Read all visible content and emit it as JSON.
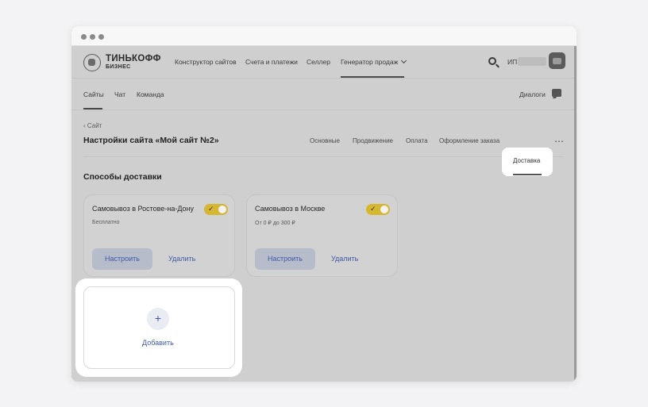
{
  "brand": {
    "name": "ТИНЬКОФФ",
    "subtitle": "БИЗНЕС"
  },
  "top_nav": {
    "items": [
      "Конструктор сайтов",
      "Счета и платежи",
      "Селлер",
      "Генератор продаж"
    ],
    "account_label": "ИП"
  },
  "sub_nav": {
    "items": [
      "Сайты",
      "Чат",
      "Команда"
    ],
    "dialogs_label": "Диалоги"
  },
  "page": {
    "back_label": "Сайт",
    "title": "Настройки сайта «Мой сайт №2»",
    "tabs": [
      "Основные",
      "Продвижение",
      "Оплата",
      "Оформление заказа",
      "Доставка"
    ],
    "active_tab": "Доставка",
    "more": "⋯"
  },
  "delivery": {
    "section_title": "Способы доставки",
    "methods": [
      {
        "title": "Самовывоз в Ростове-на-Дону",
        "price": "Бесплатно",
        "enabled": true,
        "configure_label": "Настроить",
        "delete_label": "Удалить"
      },
      {
        "title": "Самовывоз в Москве",
        "price": "От 0 ₽ до 300 ₽",
        "enabled": true,
        "configure_label": "Настроить",
        "delete_label": "Удалить"
      }
    ],
    "add_label": "Добавить",
    "add_symbol": "+"
  },
  "colors": {
    "toggle_on": "#d6b731",
    "link": "#3f5aa4",
    "overlay": "#cfcfcf"
  },
  "icons": [
    "tinkoff-logo-icon",
    "chevron-down-icon",
    "search-icon",
    "avatar-icon",
    "chat-icon",
    "chevron-left-icon",
    "check-icon",
    "plus-icon",
    "more-icon"
  ]
}
